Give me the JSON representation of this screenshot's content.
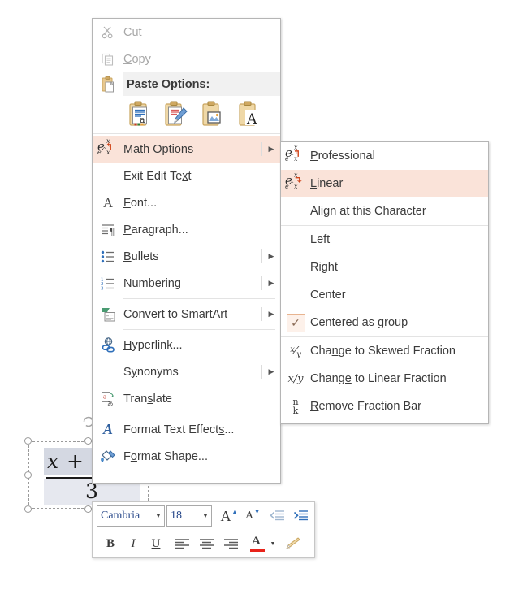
{
  "math_object": {
    "numerator": "x + 3",
    "denominator": "3"
  },
  "context_menu": {
    "items": [
      {
        "id": "cut",
        "label": "Cut",
        "underline": "t",
        "icon": "scissors-icon",
        "disabled": true,
        "submenu": false
      },
      {
        "id": "copy",
        "label": "Copy",
        "underline": "C",
        "icon": "copy-icon",
        "disabled": true,
        "submenu": false
      },
      {
        "id": "paste-options",
        "label": "Paste Options:",
        "icon": "clipboard-icon",
        "disabled": false,
        "submenu": false
      },
      {
        "id": "math-options",
        "label": "Math Options",
        "underline": "M",
        "icon": "math-options-icon",
        "disabled": false,
        "submenu": true,
        "highlighted": true
      },
      {
        "id": "exit-edit-text",
        "label": "Exit Edit Text",
        "underline": "x",
        "icon": "",
        "disabled": false,
        "submenu": false
      },
      {
        "id": "font",
        "label": "Font...",
        "underline": "F",
        "icon": "font-icon",
        "disabled": false,
        "submenu": false
      },
      {
        "id": "paragraph",
        "label": "Paragraph...",
        "underline": "P",
        "icon": "paragraph-icon",
        "disabled": false,
        "submenu": false
      },
      {
        "id": "bullets",
        "label": "Bullets",
        "underline": "B",
        "icon": "bullets-icon",
        "disabled": false,
        "submenu": true
      },
      {
        "id": "numbering",
        "label": "Numbering",
        "underline": "N",
        "icon": "numbering-icon",
        "disabled": false,
        "submenu": true
      },
      {
        "id": "convert-to-smartart",
        "label": "Convert to SmartArt",
        "underline": "m",
        "icon": "smartart-icon",
        "disabled": false,
        "submenu": true
      },
      {
        "id": "hyperlink",
        "label": "Hyperlink...",
        "underline": "H",
        "icon": "hyperlink-icon",
        "disabled": false,
        "submenu": false
      },
      {
        "id": "synonyms",
        "label": "Synonyms",
        "underline": "y",
        "icon": "",
        "disabled": false,
        "submenu": true
      },
      {
        "id": "translate",
        "label": "Translate",
        "underline": "s",
        "icon": "translate-icon",
        "disabled": false,
        "submenu": false
      },
      {
        "id": "format-text-effects",
        "label": "Format Text Effects...",
        "underline": "s",
        "icon": "text-effects-icon",
        "disabled": false,
        "submenu": false
      },
      {
        "id": "format-shape",
        "label": "Format Shape...",
        "underline": "o",
        "icon": "format-shape-icon",
        "disabled": false,
        "submenu": false
      }
    ],
    "paste_option_icons": [
      {
        "id": "use-destination-theme",
        "name": "paste-use-destination-theme-icon"
      },
      {
        "id": "keep-source-formatting",
        "name": "paste-keep-source-formatting-icon"
      },
      {
        "id": "picture",
        "name": "paste-picture-icon"
      },
      {
        "id": "keep-text-only",
        "name": "paste-keep-text-only-icon"
      }
    ]
  },
  "math_submenu": {
    "items": [
      {
        "id": "professional",
        "label": "Professional",
        "underline": "P",
        "icon": "math-professional-icon",
        "highlighted": false,
        "checked": false
      },
      {
        "id": "linear",
        "label": "Linear",
        "underline": "L",
        "icon": "math-linear-icon",
        "highlighted": true,
        "checked": false
      },
      {
        "id": "align-at-this-character",
        "label": "Align at this Character",
        "underline": "g",
        "icon": "",
        "highlighted": false,
        "checked": false
      },
      {
        "id": "left",
        "label": "Left",
        "underline": "",
        "icon": "",
        "highlighted": false,
        "checked": false
      },
      {
        "id": "right",
        "label": "Right",
        "underline": "",
        "icon": "",
        "highlighted": false,
        "checked": false
      },
      {
        "id": "center",
        "label": "Center",
        "underline": "",
        "icon": "",
        "highlighted": false,
        "checked": false
      },
      {
        "id": "centered-as-group",
        "label": "Centered as group",
        "underline": "g",
        "icon": "check-icon",
        "highlighted": false,
        "checked": true
      },
      {
        "id": "change-to-skewed-fraction",
        "label": "Change to Skewed Fraction",
        "underline": "ng",
        "icon": "skewed-fraction-icon",
        "highlighted": false,
        "checked": false
      },
      {
        "id": "change-to-linear-fraction",
        "label": "Change to Linear Fraction",
        "underline": "ge",
        "icon": "linear-fraction-icon",
        "highlighted": false,
        "checked": false
      },
      {
        "id": "remove-fraction-bar",
        "label": "Remove Fraction Bar",
        "underline": "R",
        "icon": "remove-fraction-bar-icon",
        "highlighted": false,
        "checked": false
      }
    ],
    "icon_glyphs": {
      "skewed_fraction": "x/y",
      "linear_fraction": "x/y",
      "remove_fraction_bar_top": "n",
      "remove_fraction_bar_bottom": "k",
      "check": "✓"
    }
  },
  "mini_toolbar": {
    "font_name": "Cambria",
    "font_size": "18",
    "buttons": [
      {
        "id": "grow-font",
        "label": "A",
        "name": "grow-font-button"
      },
      {
        "id": "shrink-font",
        "label": "A",
        "name": "shrink-font-button"
      },
      {
        "id": "decrease-indent",
        "label": "",
        "name": "decrease-indent-button"
      },
      {
        "id": "increase-indent",
        "label": "",
        "name": "increase-indent-button"
      },
      {
        "id": "bold",
        "label": "B",
        "name": "bold-button"
      },
      {
        "id": "italic",
        "label": "I",
        "name": "italic-button"
      },
      {
        "id": "underline",
        "label": "U",
        "name": "underline-button"
      },
      {
        "id": "align-left",
        "label": "",
        "name": "align-left-button"
      },
      {
        "id": "align-center",
        "label": "",
        "name": "align-center-button"
      },
      {
        "id": "align-right",
        "label": "",
        "name": "align-right-button"
      },
      {
        "id": "font-color",
        "label": "A",
        "name": "font-color-button"
      },
      {
        "id": "format-painter",
        "label": "",
        "name": "format-painter-button"
      }
    ],
    "font_color": "#e8231a"
  },
  "colors": {
    "highlight": "#fae3d9",
    "menu_border": "#b5b5b5",
    "paste_header_bg": "#f1f1f1",
    "text": "#3b3b3b",
    "disabled_text": "#a8a8a8",
    "selection_fill": "#d4d8e2",
    "accent_orange": "#d0451b"
  }
}
